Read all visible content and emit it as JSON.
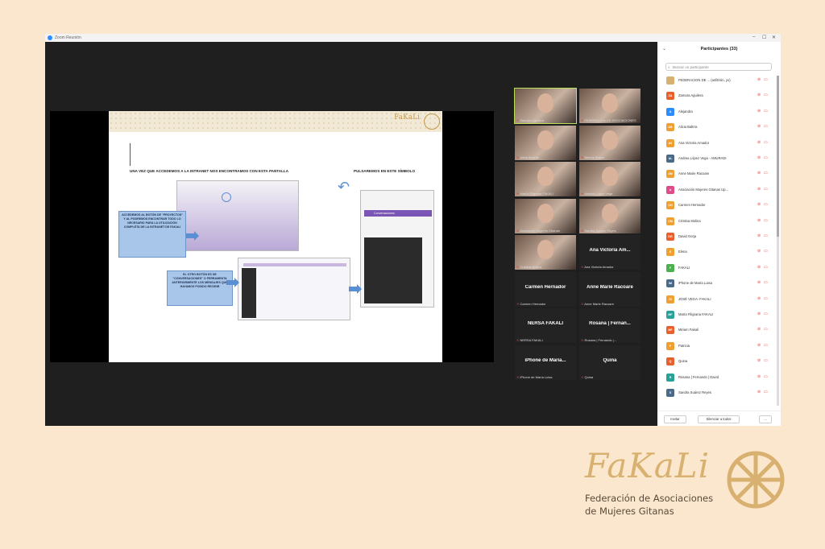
{
  "window": {
    "title": "Zoom Reunión"
  },
  "slide": {
    "brand": "FaKaLi",
    "heading_left": "UNA VEZ QUE ACCEDEMOS A LA INTRANET NOS ENCONTRAMOS CON ESTA PANTALLA",
    "heading_right": "PULSAREMOS EN ESTE SÍMBOLO",
    "callout_1": "ACCEDEMOS AL BOTÓN DE \"PROYECTOS\" Y AL PODREMOS ENCONTRAR TODO LO NECESARIO PARA LA UTILIZACIÓN COMPLETA DE LA INTRANET DE FAKALI",
    "callout_2": "EL OTRO BOTÓN ES DE \"CONVERSACIONES\" O FERRAMENTA ANTERIORMENTE LOS MENSAJES QUE HAYAMOS PODIDO RECIBIR",
    "menu_label": "Conversaciones"
  },
  "gallery": [
    {
      "name": "Zamara Aguilera",
      "video": true,
      "active": true
    },
    {
      "name": "FEDERACION DE ASOCIACIONES",
      "video": true
    },
    {
      "name": "Alicia Bertrán",
      "video": true
    },
    {
      "name": "Nieves Reyes",
      "video": true
    },
    {
      "name": "María Filigrana FAKALI",
      "video": true
    },
    {
      "name": "Andrea López Vega",
      "video": true
    },
    {
      "name": "Asociación Mujeres Gitanas",
      "video": true
    },
    {
      "name": "Sandra Suárez Reyes",
      "video": true
    },
    {
      "name": "Cristina Molina",
      "video": true
    },
    {
      "name": "Ana Victoria Amador",
      "big": "Ana Victoria Am..."
    },
    {
      "name": "Carmen Hernador",
      "big": "Carmen Hernador"
    },
    {
      "name": "Anne Marie Racoare",
      "big": "Anne Marie Racoare"
    },
    {
      "name": "NERSA FAKALI",
      "big": "NERSA FAKALI"
    },
    {
      "name": "Rosana | Fernando |...",
      "big": "Rosana | Fernan..."
    },
    {
      "name": "iPhone de María Luisa",
      "big": "iPhone de María..."
    },
    {
      "name": "Quina",
      "big": "Quina"
    }
  ],
  "panel": {
    "title": "Participantes (33)",
    "search_placeholder": "Buscar un participante",
    "participants": [
      {
        "initials": "",
        "name": "FEDERACION DE ... (anfitrión, yo)",
        "color": "#d8b170"
      },
      {
        "initials": "ZA",
        "name": "Zamara Aguilera",
        "color": "#e8612c"
      },
      {
        "initials": "A",
        "name": "Alejandra",
        "color": "#2d8cff"
      },
      {
        "initials": "AB",
        "name": "Alicia Baltrra",
        "color": "#f0a030"
      },
      {
        "initials": "AV",
        "name": "Ana Victoria Amador",
        "color": "#f0a030"
      },
      {
        "initials": "AL",
        "name": "Andrea López Vega - AMURADI",
        "color": "#4a6a8a"
      },
      {
        "initials": "AM",
        "name": "Anne Marie Racoare",
        "color": "#f0a030"
      },
      {
        "initials": "A",
        "name": "Asociación Mujeres Gitanas Up...",
        "color": "#e04a8a"
      },
      {
        "initials": "CH",
        "name": "Carmen Hernador",
        "color": "#f0a030"
      },
      {
        "initials": "CM",
        "name": "Cristina Molina",
        "color": "#f0a030"
      },
      {
        "initials": "DG",
        "name": "David Gorja",
        "color": "#e8612c"
      },
      {
        "initials": "E",
        "name": "Elena",
        "color": "#f0a030"
      },
      {
        "initials": "F",
        "name": "FAKALI",
        "color": "#4caf50"
      },
      {
        "initials": "IM",
        "name": "iPhone de María Luisa",
        "color": "#4a6a8a"
      },
      {
        "initials": "JV",
        "name": "JOSÉ VEGA- FAKALI",
        "color": "#f0a030"
      },
      {
        "initials": "MF",
        "name": "María Filigrana FAKALI",
        "color": "#2aa198"
      },
      {
        "initials": "MF",
        "name": "Miriam Fakali",
        "color": "#e8612c"
      },
      {
        "initials": "P",
        "name": "Patricia",
        "color": "#f0a030"
      },
      {
        "initials": "Q",
        "name": "Quina",
        "color": "#e8612c"
      },
      {
        "initials": "R",
        "name": "Rosana | Fernando | David",
        "color": "#2aa198"
      },
      {
        "initials": "S",
        "name": "Sandra Suárez Reyes",
        "color": "#4a6a8a"
      }
    ],
    "invite": "Invitar",
    "mute_all": "Silenciar a todos",
    "more": "..."
  },
  "brand": {
    "name": "FaKaLi",
    "line1": "Federación de Asociaciones",
    "line2": "de Mujeres Gitanas"
  }
}
